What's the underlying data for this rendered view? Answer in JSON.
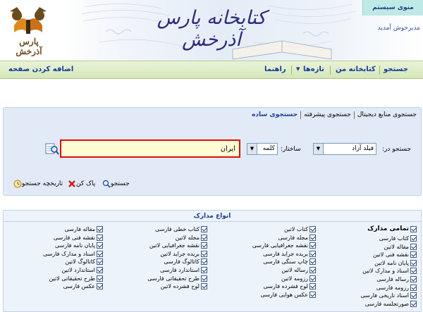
{
  "header": {
    "site_title": "کتابخانه پارس آذرخش",
    "logo_text": "پارس آذرخش",
    "system_menu": "منوی سیستم",
    "welcome": "مدیرخوش آمدید"
  },
  "nav": {
    "items": [
      "جستجو",
      "کتابخانه من",
      "تازه‌ها",
      "راهنما"
    ],
    "add_page": "اضافه کردن صفحه"
  },
  "search": {
    "tabs": [
      "جستجوی ساده",
      "جستجوی پیشرفته",
      "جستجوی منابع دیجیتال"
    ],
    "search_in_label": "جستجو در:",
    "search_in_value": "فیلد آزاد",
    "structure_label": "ساختار:",
    "structure_value": "کلمه",
    "query_value": "ایران",
    "buttons": {
      "search": "جستجو",
      "clear": "پاک کن",
      "history": "تاریخچه جستجو"
    }
  },
  "doc_types": {
    "title": "انواع مدارک",
    "all_label": "تمامی مدارک",
    "columns": [
      [
        "کتاب فارسی",
        "مقاله لاتین",
        "نقشه فنی لاتین",
        "پایان نامه لاتین",
        "اسناد و مدارک لاتین",
        "رساله فارسی",
        "رزومه فارسی",
        "اسناد تاریخی فارسی",
        "صورتجلسه فارسی"
      ],
      [
        "کتاب لاتین",
        "مجله فارسی",
        "نقشه جغرافیایی فارسی",
        "بریده جراید فارسی",
        "چاپ سنگی فارسی",
        "رساله لاتین",
        "رزومه لاتین",
        "لوح فشرده فارسی",
        "عکس هوایی فارسی"
      ],
      [
        "کتاب خطی فارسی",
        "مجله لاتین",
        "نقشه جغرافیایی لاتین",
        "بریده جراید لاتین",
        "کاتالوگ فارسی",
        "استاندارد فارسی",
        "طرح تحقیقاتی فارسی",
        "لوح فشرده لاتین"
      ],
      [
        "مقاله فارسی",
        "نقشه فنی فارسی",
        "پایان نامه فارسی",
        "اسناد و مدارک فارسی",
        "کاتالوگ لاتین",
        "استاندارد لاتین",
        "طرح تحقیقاتی لاتین",
        "عکس فارسی"
      ]
    ]
  }
}
